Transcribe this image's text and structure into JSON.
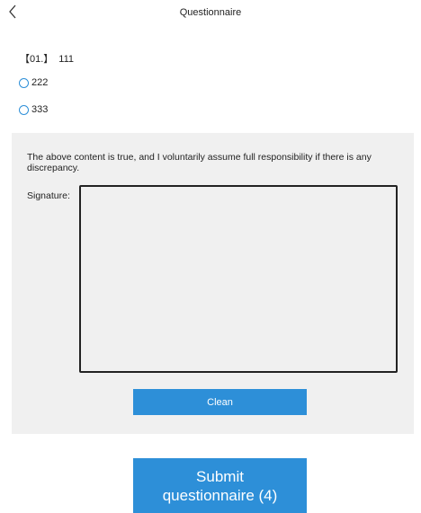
{
  "header": {
    "back_icon": "chevron-left-icon",
    "title": "Questionnaire"
  },
  "question": {
    "number": "【01.】",
    "text": "111",
    "options": [
      {
        "label": "222",
        "selected": false
      },
      {
        "label": "333",
        "selected": false
      }
    ]
  },
  "declaration": {
    "text": "The above content is true, and I voluntarily assume full responsibility if there is any discrepancy.",
    "signature_label": "Signature:",
    "clean_label": "Clean"
  },
  "submit": {
    "line1": "Submit",
    "line2": "questionnaire (4)"
  },
  "colors": {
    "accent": "#2d8fd8",
    "panel_bg": "#f0f0f0"
  }
}
